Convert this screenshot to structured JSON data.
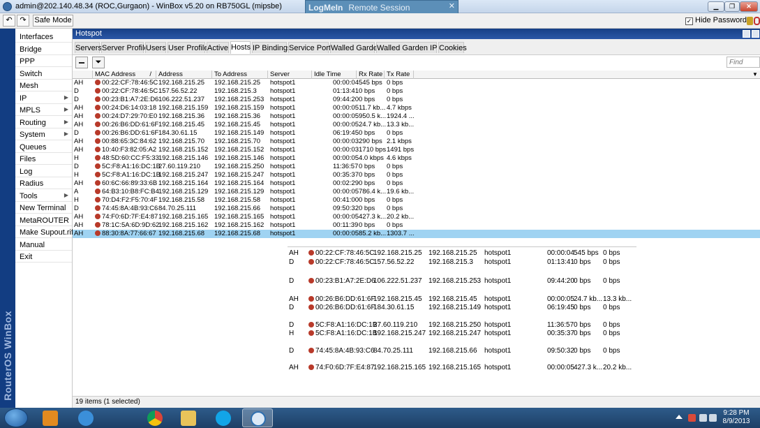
{
  "window": {
    "title": "admin@202.140.48.34 (ROC,Gurgaon) - WinBox v5.20 on RB750GL (mipsbe)",
    "remote_brand": "LogMeIn",
    "remote_session": "Remote Session"
  },
  "toolbar": {
    "undo_label": "↶",
    "redo_label": "↷",
    "safe_mode": "Safe Mode",
    "hide_passwords": "Hide Passwords",
    "hide_passwords_checked": "✓"
  },
  "brand_strip": "RouterOS WinBox",
  "menu": [
    {
      "label": "Interfaces",
      "arrow": ""
    },
    {
      "label": "Bridge",
      "arrow": ""
    },
    {
      "label": "PPP",
      "arrow": ""
    },
    {
      "label": "Switch",
      "arrow": ""
    },
    {
      "label": "Mesh",
      "arrow": ""
    },
    {
      "label": "IP",
      "arrow": "▶"
    },
    {
      "label": "MPLS",
      "arrow": "▶"
    },
    {
      "label": "Routing",
      "arrow": "▶"
    },
    {
      "label": "System",
      "arrow": "▶"
    },
    {
      "label": "Queues",
      "arrow": ""
    },
    {
      "label": "Files",
      "arrow": ""
    },
    {
      "label": "Log",
      "arrow": ""
    },
    {
      "label": "Radius",
      "arrow": ""
    },
    {
      "label": "Tools",
      "arrow": "▶"
    },
    {
      "label": "New Terminal",
      "arrow": ""
    },
    {
      "label": "MetaROUTER",
      "arrow": ""
    },
    {
      "label": "Make Supout.rif",
      "arrow": ""
    },
    {
      "label": "Manual",
      "arrow": ""
    },
    {
      "label": "Exit",
      "arrow": ""
    }
  ],
  "hotspot": {
    "title": "Hotspot",
    "tabs": [
      "Servers",
      "Server Profiles",
      "Users",
      "User Profiles",
      "Active",
      "Hosts",
      "IP Bindings",
      "Service Ports",
      "Walled Garden",
      "Walled Garden IP List",
      "Cookies"
    ],
    "active_tab": "Hosts",
    "find_placeholder": "Find",
    "filter_icon": "⏷",
    "columns": [
      "",
      "MAC Address",
      "Address",
      "To Address",
      "Server",
      "Idle Time",
      "Rx Rate",
      "Tx Rate"
    ],
    "sort_indicator": "/",
    "rows": [
      [
        "AH",
        "00:22:CF:78:46:5C",
        "192.168.215.25",
        "192.168.215.25",
        "hotspot1",
        "00:00:04",
        "545 bps",
        "0 bps"
      ],
      [
        "D",
        "00:22:CF:78:46:5C",
        "157.56.52.22",
        "192.168.215.3",
        "hotspot1",
        "01:13:41",
        "0 bps",
        "0 bps"
      ],
      [
        "D",
        "00:23:B1:A7:2E:D6",
        "106.222.51.237",
        "192.168.215.253",
        "hotspot1",
        "09:44:20",
        "0 bps",
        "0 bps"
      ],
      [
        "AH",
        "00:24:D6:14:03:18",
        "192.168.215.159",
        "192.168.215.159",
        "hotspot1",
        "00:00:05",
        "11.7 kb...",
        "4.7 kbps"
      ],
      [
        "AH",
        "00:24:D7:29:70:E0",
        "192.168.215.36",
        "192.168.215.36",
        "hotspot1",
        "00:00:05",
        "950.5 k...",
        "1924.4 ..."
      ],
      [
        "AH",
        "00:26:B6:DD:61:6F",
        "192.168.215.45",
        "192.168.215.45",
        "hotspot1",
        "00:00:05",
        "24.7 kb...",
        "13.3 kb..."
      ],
      [
        "D",
        "00:26:B6:DD:61:6F",
        "184.30.61.15",
        "192.168.215.149",
        "hotspot1",
        "06:19:45",
        "0 bps",
        "0 bps"
      ],
      [
        "AH",
        "00:88:65:3C:84:62",
        "192.168.215.70",
        "192.168.215.70",
        "hotspot1",
        "00:00:03",
        "290 bps",
        "2.1 kbps"
      ],
      [
        "AH",
        "10:40:F3:82:05:A2",
        "192.168.215.152",
        "192.168.215.152",
        "hotspot1",
        "00:00:03",
        "1710 bps",
        "1491 bps"
      ],
      [
        "H",
        "48:5D:60:CC:F5:33",
        "192.168.215.146",
        "192.168.215.146",
        "hotspot1",
        "00:00:05",
        "4.0 kbps",
        "4.6 kbps"
      ],
      [
        "D",
        "5C:F8:A1:16:DC:1B",
        "27.60.119.210",
        "192.168.215.250",
        "hotspot1",
        "11:36:57",
        "0 bps",
        "0 bps"
      ],
      [
        "H",
        "5C:F8:A1:16:DC:1B",
        "192.168.215.247",
        "192.168.215.247",
        "hotspot1",
        "00:35:37",
        "0 bps",
        "0 bps"
      ],
      [
        "AH",
        "60:6C:66:89:33:6B",
        "192.168.215.164",
        "192.168.215.164",
        "hotspot1",
        "00:02:29",
        "0 bps",
        "0 bps"
      ],
      [
        "A",
        "64:B3:10:B8:FC:B4",
        "192.168.215.129",
        "192.168.215.129",
        "hotspot1",
        "00:00:05",
        "786.4 k...",
        "19.6 kb..."
      ],
      [
        "H",
        "70:D4:F2:F5:70:4F",
        "192.168.215.58",
        "192.168.215.58",
        "hotspot1",
        "00:41:00",
        "0 bps",
        "0 bps"
      ],
      [
        "D",
        "74:45:8A:4B:93:C6",
        "84.70.25.111",
        "192.168.215.66",
        "hotspot1",
        "09:50:32",
        "0 bps",
        "0 bps"
      ],
      [
        "AH",
        "74:F0:6D:7F:E4:87",
        "192.168.215.165",
        "192.168.215.165",
        "hotspot1",
        "00:00:05",
        "427.3 k...",
        "20.2 kb..."
      ],
      [
        "AH",
        "78:1C:5A:6D:9D:62",
        "192.168.215.162",
        "192.168.215.162",
        "hotspot1",
        "00:11:39",
        "0 bps",
        "0 bps"
      ],
      [
        "AH",
        "88:30:8A:77:66:67",
        "192.168.215.68",
        "192.168.215.68",
        "hotspot1",
        "00:00:05",
        "85.2 kb...",
        "1303.7 ..."
      ]
    ],
    "selected_row": 18,
    "zoom_rows": [
      [
        "AH",
        "00:22:CF:78:46:5C",
        "192.168.215.25",
        "192.168.215.25",
        "hotspot1",
        "00:00:04",
        "545 bps",
        "0 bps"
      ],
      [
        "D",
        "00:22:CF:78:46:5C",
        "157.56.52.22",
        "192.168.215.3",
        "hotspot1",
        "01:13:41",
        "0 bps",
        "0 bps"
      ],
      [
        "D",
        "00:23:B1:A7:2E:D6",
        "106.222.51.237",
        "192.168.215.253",
        "hotspot1",
        "09:44:20",
        "0 bps",
        "0 bps"
      ],
      [
        "AH",
        "00:26:B6:DD:61:6F",
        "192.168.215.45",
        "192.168.215.45",
        "hotspot1",
        "00:00:05",
        "24.7 kb...",
        "13.3 kb..."
      ],
      [
        "D",
        "00:26:B6:DD:61:6F",
        "184.30.61.15",
        "192.168.215.149",
        "hotspot1",
        "06:19:45",
        "0 bps",
        "0 bps"
      ],
      [
        "D",
        "5C:F8:A1:16:DC:1B",
        "27.60.119.210",
        "192.168.215.250",
        "hotspot1",
        "11:36:57",
        "0 bps",
        "0 bps"
      ],
      [
        "H",
        "5C:F8:A1:16:DC:1B",
        "192.168.215.247",
        "192.168.215.247",
        "hotspot1",
        "00:35:37",
        "0 bps",
        "0 bps"
      ],
      [
        "D",
        "74:45:8A:4B:93:C6",
        "84.70.25.111",
        "192.168.215.66",
        "hotspot1",
        "09:50:32",
        "0 bps",
        "0 bps"
      ],
      [
        "AH",
        "74:F0:6D:7F:E4:87",
        "192.168.215.165",
        "192.168.215.165",
        "hotspot1",
        "00:00:05",
        "427.3 k...",
        "20.2 kb..."
      ]
    ],
    "status": "19 items (1 selected)"
  },
  "clock": {
    "time": "9:28 PM",
    "date": "8/9/2013"
  },
  "colors": {
    "brand_strip": "#123d82",
    "selected_row": "#9fd3f2",
    "host_icon": "#b83a2a"
  }
}
